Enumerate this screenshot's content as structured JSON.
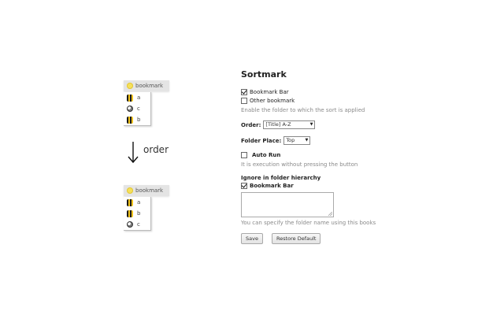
{
  "illustration": {
    "before": {
      "folder_label": "bookmark",
      "items": [
        {
          "icon": "bee-icon",
          "label": "a"
        },
        {
          "icon": "globe-icon",
          "label": "c"
        },
        {
          "icon": "bee-icon",
          "label": "b"
        }
      ]
    },
    "order_label": "order",
    "after": {
      "folder_label": "bookmark",
      "items": [
        {
          "icon": "bee-icon",
          "label": "a"
        },
        {
          "icon": "bee-icon",
          "label": "b"
        },
        {
          "icon": "globe-icon",
          "label": "c"
        }
      ]
    }
  },
  "settings": {
    "title": "Sortmark",
    "bookmark_bar_label": "Bookmark Bar",
    "bookmark_bar_checked": true,
    "other_bookmark_label": "Other bookmark",
    "other_bookmark_checked": false,
    "folder_hint": "Enable the folder to which the sort is applied",
    "order_label": "Order:",
    "order_value": "[Title] A-Z",
    "folder_place_label": "Folder Place:",
    "folder_place_value": "Top",
    "auto_run_label": "Auto Run",
    "auto_run_checked": false,
    "auto_run_hint": "It is execution without pressing the button",
    "ignore_label": "Ignore in folder hierarchy",
    "ignore_bookmark_bar_label": "Bookmark Bar",
    "ignore_bookmark_bar_checked": true,
    "ignore_textarea_value": "",
    "ignore_hint": "You can specify the folder name using this books",
    "save_label": "Save",
    "restore_label": "Restore Default"
  },
  "colors": {
    "folder_icon": "#f6e05a",
    "hint_text": "#8a8a8a",
    "menu_header": "#e4e4e4"
  }
}
